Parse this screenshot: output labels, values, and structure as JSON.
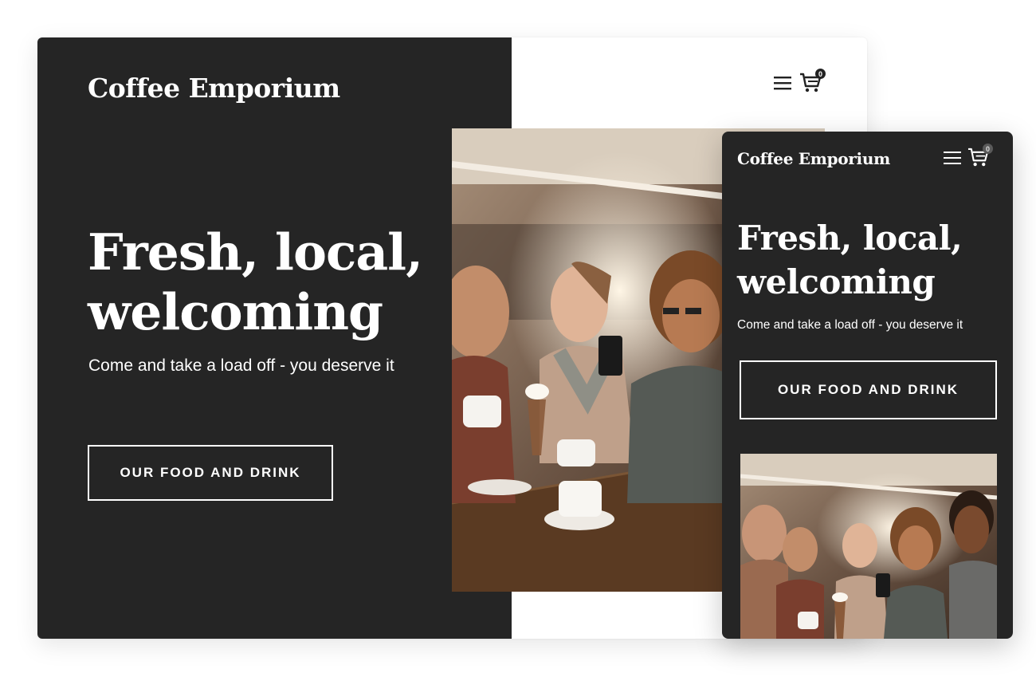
{
  "brand": {
    "name": "Coffee Emporium"
  },
  "hero": {
    "title": "Fresh, local, welcoming",
    "tagline": "Come and take a load off - you deserve it",
    "cta_label": "OUR FOOD AND DRINK"
  },
  "header": {
    "menu_icon": "hamburger-menu-icon",
    "cart_icon": "shopping-cart-icon",
    "cart_count": "0"
  },
  "photo": {
    "description_icon": "cafe-friends-photo"
  },
  "colors": {
    "dark_panel": "#252525",
    "text": "#ffffff",
    "page_background": "#ffffff"
  }
}
